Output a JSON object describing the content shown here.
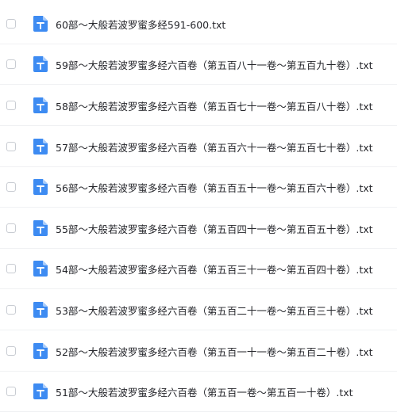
{
  "file_list": {
    "items": [
      {
        "name": "60部～大般若波罗蜜多经591-600.txt",
        "icon": "txt-document-icon"
      },
      {
        "name": "59部～大般若波罗蜜多经六百卷（第五百八十一卷～第五百九十卷）.txt",
        "icon": "txt-document-icon"
      },
      {
        "name": "58部～大般若波罗蜜多经六百卷（第五百七十一卷～第五百八十卷）.txt",
        "icon": "txt-document-icon"
      },
      {
        "name": "57部～大般若波罗蜜多经六百卷（第五百六十一卷～第五百七十卷）.txt",
        "icon": "txt-document-icon"
      },
      {
        "name": "56部～大般若波罗蜜多经六百卷（第五百五十一卷～第五百六十卷）.txt",
        "icon": "txt-document-icon"
      },
      {
        "name": "55部～大般若波罗蜜多经六百卷（第五百四十一卷～第五百五十卷）.txt",
        "icon": "txt-document-icon"
      },
      {
        "name": "54部～大般若波罗蜜多经六百卷（第五百三十一卷～第五百四十卷）.txt",
        "icon": "txt-document-icon"
      },
      {
        "name": "53部～大般若波罗蜜多经六百卷（第五百二十一卷～第五百三十卷）.txt",
        "icon": "txt-document-icon"
      },
      {
        "name": "52部～大般若波罗蜜多经六百卷（第五百一十一卷～第五百二十卷）.txt",
        "icon": "txt-document-icon"
      },
      {
        "name": "51部～大般若波罗蜜多经六百卷（第五百一卷～第五百一十卷）.txt",
        "icon": "txt-document-icon"
      }
    ]
  },
  "colors": {
    "icon_blue": "#3d8bf2",
    "icon_fold": "#a8ccfa",
    "text": "#25262b",
    "divider": "#f0f1f3"
  }
}
